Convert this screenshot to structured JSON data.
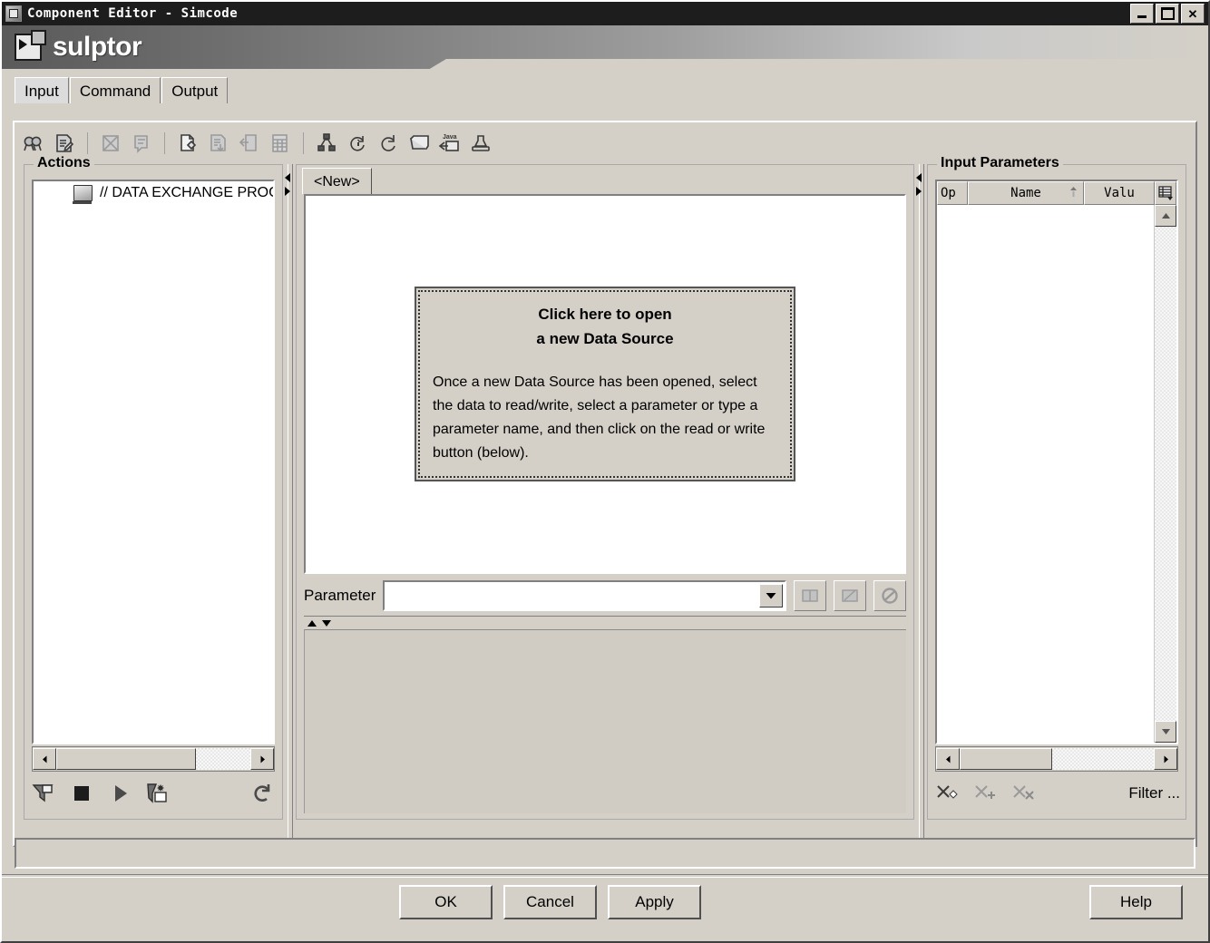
{
  "window": {
    "title": "Component Editor - Simcode",
    "icon": "app-icon",
    "controls": {
      "minimize": "_",
      "maximize": "□",
      "close": "✕"
    }
  },
  "banner": {
    "title": "sulptor",
    "icon": "script-window-icon"
  },
  "tabs": [
    {
      "label": "Input",
      "active": true
    },
    {
      "label": "Command",
      "active": false
    },
    {
      "label": "Output",
      "active": false
    }
  ],
  "toolbar": [
    {
      "name": "find-icon",
      "enabled": true
    },
    {
      "name": "edit-document-icon",
      "enabled": true
    },
    {
      "name": "separator"
    },
    {
      "name": "delete-crossbox-icon",
      "enabled": false
    },
    {
      "name": "comment-document-icon",
      "enabled": false
    },
    {
      "name": "separator"
    },
    {
      "name": "new-document-icon",
      "enabled": true
    },
    {
      "name": "save-document-icon",
      "enabled": false
    },
    {
      "name": "import-document-icon",
      "enabled": false
    },
    {
      "name": "calculator-icon",
      "enabled": false
    },
    {
      "name": "separator"
    },
    {
      "name": "hierarchy-icon",
      "enabled": true
    },
    {
      "name": "refresh-info-icon",
      "enabled": true
    },
    {
      "name": "reload-icon",
      "enabled": true
    },
    {
      "name": "panel-icon",
      "enabled": true
    },
    {
      "name": "java-export-icon",
      "enabled": true,
      "badge": "Java"
    },
    {
      "name": "stamp-icon",
      "enabled": true
    }
  ],
  "actions_panel": {
    "title": "Actions",
    "items": [
      {
        "label": "// DATA EXCHANGE PROG",
        "icon": "program-node-icon"
      }
    ],
    "footer_buttons": [
      {
        "name": "filter-actions-icon"
      },
      {
        "name": "stop-icon"
      },
      {
        "name": "run-icon"
      },
      {
        "name": "new-action-icon"
      },
      {
        "name": "reset-icon"
      }
    ],
    "hscroll": {
      "left_arrow": "◄",
      "right_arrow": "►"
    }
  },
  "center_panel": {
    "tab": {
      "label": "<New>"
    },
    "datasource_box": {
      "title_line1": "Click here to open",
      "title_line2": "a new Data Source",
      "body": "Once a new Data Source has been opened, select the data to read/write, select a parameter or type a parameter name, and then click on the read or write button (below)."
    },
    "parameter": {
      "label": "Parameter",
      "value": "",
      "placeholder": "",
      "dropdown_icon": "chevron-down-icon",
      "buttons": [
        {
          "name": "read-parameter-icon",
          "enabled": false
        },
        {
          "name": "write-parameter-icon",
          "enabled": false
        },
        {
          "name": "cancel-parameter-icon",
          "enabled": false
        }
      ]
    },
    "splitter": {
      "up_icon": "triangle-up-icon",
      "down_icon": "triangle-down-icon"
    }
  },
  "input_parameters": {
    "title": "Input Parameters",
    "columns": [
      "Op",
      "Name",
      "Valu"
    ],
    "sort_column": "Name",
    "rows": [],
    "column_chooser_icon": "table-columns-icon",
    "footer_buttons": [
      {
        "name": "new-parameter-icon"
      },
      {
        "name": "add-parameter-icon"
      },
      {
        "name": "delete-parameter-icon"
      }
    ],
    "filter_label": "Filter ...",
    "hscroll": {
      "left_arrow": "◄",
      "right_arrow": "►"
    },
    "vscroll": {
      "up_arrow": "▲",
      "down_arrow": "▼"
    }
  },
  "statusbar": {
    "text": ""
  },
  "dialog_buttons": {
    "ok": "OK",
    "cancel": "Cancel",
    "apply": "Apply",
    "help": "Help"
  },
  "colors": {
    "face": "#d4d0c8",
    "titlebar": "#1d1d1d",
    "banner_dark": "#5a5a5a",
    "text": "#000000"
  }
}
